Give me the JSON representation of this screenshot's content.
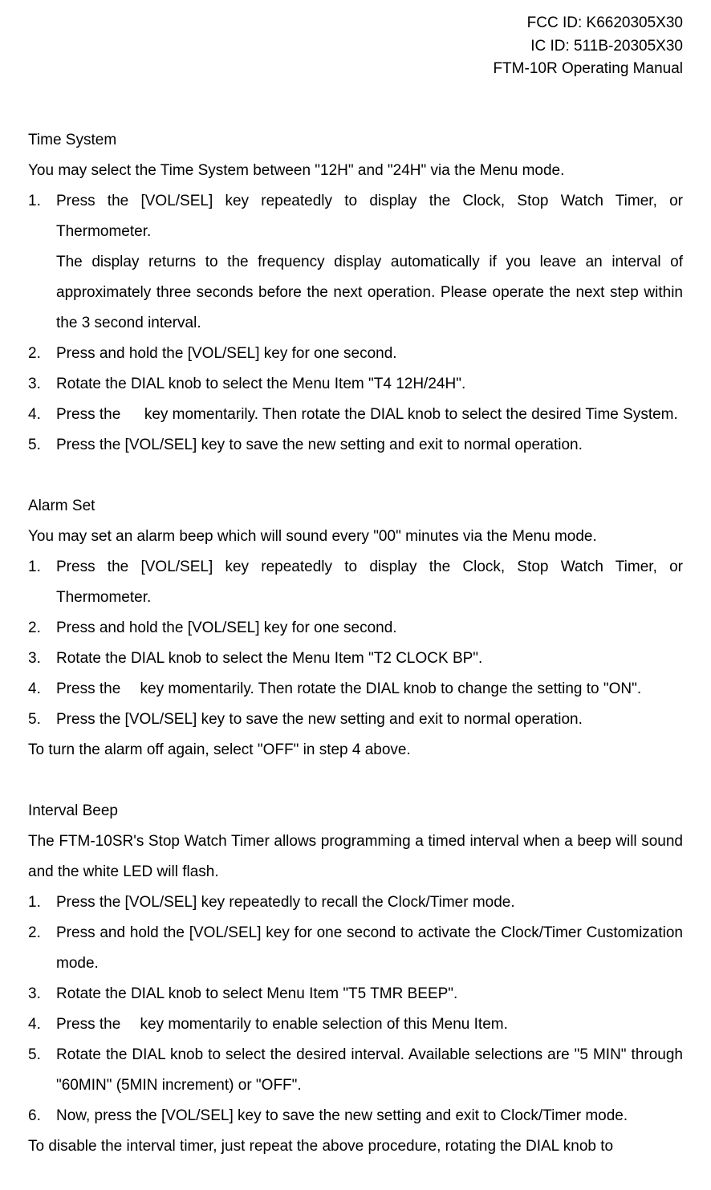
{
  "header": {
    "fcc": "FCC ID: K6620305X30",
    "ic": "IC ID: 511B-20305X30",
    "manual": "FTM-10R Operating Manual"
  },
  "sections": {
    "timeSystem": {
      "title": "Time System",
      "intro": "You may select the Time System between \"12H\" and \"24H\" via the Menu mode.",
      "items": [
        {
          "n": "1.",
          "text": "Press the [VOL/SEL] key repeatedly to display the Clock, Stop Watch Timer, or Thermometer."
        },
        {
          "text": "The display returns to the frequency display automatically if you leave an interval of approximately three seconds before the next operation. Please operate the next step within the 3 second interval."
        },
        {
          "n": "2.",
          "text": "Press and hold the [VOL/SEL] key for one second."
        },
        {
          "n": "3.",
          "text": "Rotate the DIAL knob to select the Menu Item \"T4 12H/24H\"."
        },
        {
          "n": "4.",
          "text": "Press the 　 key momentarily. Then rotate the DIAL knob to select the desired Time System."
        },
        {
          "n": "5.",
          "text": "Press the [VOL/SEL] key to save the new setting and exit to normal operation."
        }
      ]
    },
    "alarmSet": {
      "title": "Alarm Set",
      "intro": "You may set an alarm beep which will sound every \"00\" minutes via the Menu mode.",
      "items": [
        {
          "n": "1.",
          "text": "Press the [VOL/SEL] key repeatedly to display the Clock, Stop Watch Timer, or Thermometer."
        },
        {
          "n": "2.",
          "text": "Press and hold the [VOL/SEL] key for one second."
        },
        {
          "n": "3.",
          "text": "Rotate the DIAL knob to select the Menu Item \"T2 CLOCK BP\"."
        },
        {
          "n": "4.",
          "text": "Press the 　key momentarily. Then rotate the DIAL knob to change the setting to \"ON\"."
        },
        {
          "n": "5.",
          "text": "Press the [VOL/SEL] key to save the new setting and exit to normal operation."
        }
      ],
      "footer": "To turn the alarm off again, select \"OFF\" in step 4 above."
    },
    "intervalBeep": {
      "title": "Interval Beep",
      "intro": "The FTM-10SR's Stop Watch Timer allows programming a timed interval when a beep will sound and the white LED will flash.",
      "items": [
        {
          "n": "1.",
          "text": "Press the [VOL/SEL] key repeatedly to recall the Clock/Timer mode."
        },
        {
          "n": "2.",
          "text": "Press and hold the [VOL/SEL] key for one second to activate the Clock/Timer Customization mode."
        },
        {
          "n": "3.",
          "text": "Rotate the DIAL knob to select Menu Item \"T5 TMR BEEP\"."
        },
        {
          "n": "4.",
          "text": "Press the 　key momentarily to enable selection of this Menu Item."
        },
        {
          "n": "5.",
          "text": "Rotate the DIAL knob to select the desired interval. Available selections are \"5 MIN\" through \"60MIN\" (5MIN increment) or \"OFF\"."
        },
        {
          "n": "6.",
          "text": "Now, press the [VOL/SEL] key to save the new setting and exit to Clock/Timer mode."
        }
      ],
      "footer": "To disable the interval timer, just repeat the above procedure, rotating the DIAL knob to"
    }
  }
}
